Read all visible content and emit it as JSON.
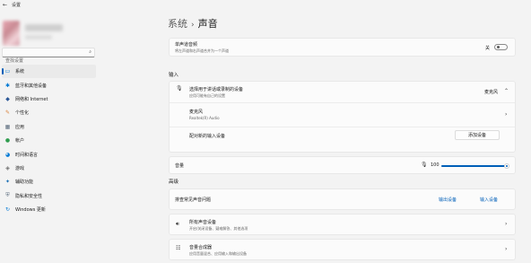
{
  "window": {
    "back_icon": "←",
    "title": "设置"
  },
  "search": {
    "placeholder": "查找设置"
  },
  "sidebar": {
    "items": [
      {
        "label": "系统",
        "icon": "display-icon",
        "glyph": "▭",
        "color": "#0078d4",
        "active": true
      },
      {
        "label": "蓝牙和其他设备",
        "icon": "bluetooth-icon",
        "glyph": "✱",
        "color": "#0078d4"
      },
      {
        "label": "网络和 Internet",
        "icon": "wifi-icon",
        "glyph": "◆",
        "color": "#2b5797"
      },
      {
        "label": "个性化",
        "icon": "brush-icon",
        "glyph": "✎",
        "color": "#d9823b"
      },
      {
        "label": "应用",
        "icon": "apps-icon",
        "glyph": "▦",
        "color": "#5a6b7d"
      },
      {
        "label": "帐户",
        "icon": "person-icon",
        "glyph": "●",
        "color": "#2e9c4e"
      },
      {
        "label": "时间和语言",
        "icon": "globe-clock-icon",
        "glyph": "◕",
        "color": "#0078d4"
      },
      {
        "label": "游戏",
        "icon": "gamepad-icon",
        "glyph": "◈",
        "color": "#6b6b6b"
      },
      {
        "label": "辅助功能",
        "icon": "accessibility-icon",
        "glyph": "✦",
        "color": "#1a6fb5"
      },
      {
        "label": "隐私和安全性",
        "icon": "shield-icon",
        "glyph": "⛨",
        "color": "#5f6f80"
      },
      {
        "label": "Windows 更新",
        "icon": "update-icon",
        "glyph": "↻",
        "color": "#0078d4"
      }
    ]
  },
  "breadcrumb": {
    "parent": "系统",
    "separator": "›",
    "current": "声音"
  },
  "mono": {
    "title": "单声道音频",
    "subtitle": "将左声道和右声道合并为一个声道",
    "toggle_label": "关"
  },
  "input": {
    "section_label": "输入",
    "choose_title": "选择用于讲话或录制的设备",
    "choose_subtitle": "应用可能有自己的设置",
    "selected_device": "麦克风",
    "device_name": "麦克风",
    "device_driver": "Realtek(R) Audio",
    "pair_label": "配对新的输入设备",
    "add_button": "添加设备",
    "volume_label": "音量",
    "volume_value": "100",
    "volume_level": 100
  },
  "advanced": {
    "section_label": "高级",
    "troubleshoot_label": "排查常见声音问题",
    "output_link": "输出设备",
    "input_link": "输入设备",
    "all_devices_title": "所有声音设备",
    "all_devices_subtitle": "开启/关闭设备、疑难解答、其他选项",
    "mixer_title": "音量合成器",
    "mixer_subtitle": "应用音量混合、应用输入和输出设备"
  }
}
